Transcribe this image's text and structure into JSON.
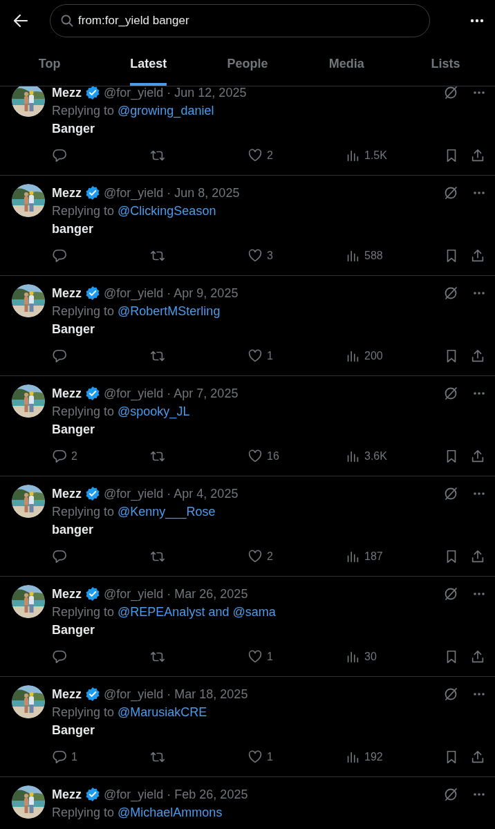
{
  "search": {
    "value": "from:for_yield banger"
  },
  "tabs": [
    {
      "label": "Top",
      "selected": false
    },
    {
      "label": "Latest",
      "selected": true
    },
    {
      "label": "People",
      "selected": false
    },
    {
      "label": "Media",
      "selected": false
    },
    {
      "label": "Lists",
      "selected": false
    }
  ],
  "tweets": [
    {
      "name": "Mezz",
      "verified": true,
      "handle": "@for_yield",
      "date": "· Jun 12, 2025",
      "reply_prefix": "Replying to",
      "reply_to": "@growing_daniel",
      "text": "Banger",
      "likes": "2",
      "views": "1.5K"
    },
    {
      "name": "Mezz",
      "verified": true,
      "handle": "@for_yield",
      "date": "· Jun 8, 2025",
      "reply_prefix": "Replying to",
      "reply_to": "@ClickingSeason",
      "text": "banger",
      "likes": "3",
      "views": "588"
    },
    {
      "name": "Mezz",
      "verified": true,
      "handle": "@for_yield",
      "date": "· Apr 9, 2025",
      "reply_prefix": "Replying to",
      "reply_to": "@RobertMSterling",
      "text": "Banger",
      "likes": "1",
      "views": "200"
    },
    {
      "name": "Mezz",
      "verified": true,
      "handle": "@for_yield",
      "date": "· Apr 7, 2025",
      "reply_prefix": "Replying to",
      "reply_to": "@spooky_JL",
      "text": "Banger",
      "replies": "2",
      "likes": "16",
      "views": "3.6K"
    },
    {
      "name": "Mezz",
      "verified": true,
      "handle": "@for_yield",
      "date": "· Apr 4, 2025",
      "reply_prefix": "Replying to",
      "reply_to": "@Kenny___Rose",
      "text": "banger",
      "likes": "2",
      "views": "187"
    },
    {
      "name": "Mezz",
      "verified": true,
      "handle": "@for_yield",
      "date": "· Mar 26, 2025",
      "reply_prefix": "Replying to",
      "reply_to": "@REPEAnalyst and @sama",
      "text": "Banger",
      "likes": "1",
      "views": "30"
    },
    {
      "name": "Mezz",
      "verified": true,
      "handle": "@for_yield",
      "date": "· Mar 18, 2025",
      "reply_prefix": "Replying to",
      "reply_to": "@MarusiakCRE",
      "text": "Banger",
      "replies": "1",
      "likes": "1",
      "views": "192"
    },
    {
      "name": "Mezz",
      "verified": true,
      "handle": "@for_yield",
      "date": "· Feb 26, 2025",
      "reply_prefix": "Replying to",
      "reply_to": "@MichaelAmmons"
    }
  ]
}
